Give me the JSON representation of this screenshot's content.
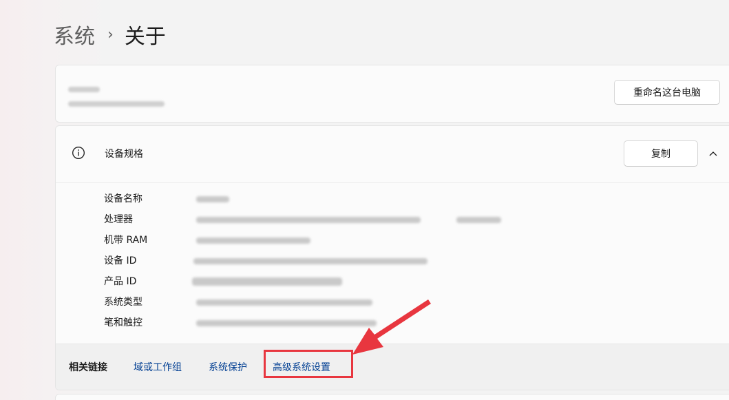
{
  "breadcrumb": {
    "parent": "系统",
    "separator": "›",
    "current": "关于"
  },
  "device": {
    "name": "",
    "model": "",
    "rename_button": "重命名这台电脑"
  },
  "specs": {
    "title": "设备规格",
    "copy_button": "复制",
    "rows": [
      {
        "label": "设备名称",
        "value": ""
      },
      {
        "label": "处理器",
        "value": ""
      },
      {
        "label": "机带 RAM",
        "value": ""
      },
      {
        "label": "设备 ID",
        "value": ""
      },
      {
        "label": "产品 ID",
        "value": ""
      },
      {
        "label": "系统类型",
        "value": ""
      },
      {
        "label": "笔和触控",
        "value": ""
      }
    ]
  },
  "related": {
    "label": "相关链接",
    "links": [
      "域或工作组",
      "系统保护",
      "高级系统设置"
    ]
  },
  "annotation": {
    "color": "#e8363f"
  },
  "icons": {
    "info": "info-icon",
    "chevron": "chevron-up-icon"
  }
}
